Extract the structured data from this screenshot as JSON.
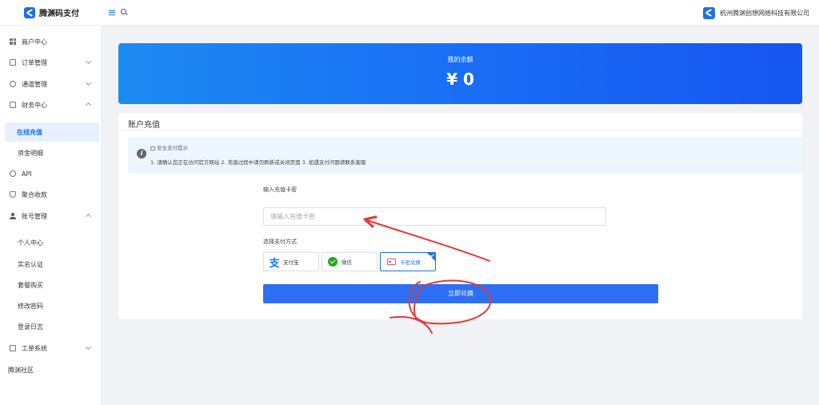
{
  "app": {
    "name": "腾渊码支付"
  },
  "header": {
    "company": "杭州腾渊创想网络科技有限公司"
  },
  "sidebar": {
    "items": [
      {
        "label": "商户中心"
      },
      {
        "label": "订单管理"
      },
      {
        "label": "通道管理"
      },
      {
        "label": "财务中心"
      },
      {
        "label": "在线充值"
      },
      {
        "label": "资金明细"
      },
      {
        "label": "API"
      },
      {
        "label": "聚合收款"
      },
      {
        "label": "账号管理"
      },
      {
        "label": "个人中心"
      },
      {
        "label": "实名认证"
      },
      {
        "label": "套餐购买"
      },
      {
        "label": "修改密码"
      },
      {
        "label": "登录日志"
      },
      {
        "label": "工单系统"
      },
      {
        "label": "腾渊社区"
      }
    ]
  },
  "balance": {
    "label": "我的余额",
    "amount": "¥ 0"
  },
  "recharge": {
    "title": "账户充值",
    "tip_title": "安全支付提示",
    "tip_text": "1. 请确认您正在访问官方网站 2. 充值过程中请勿刷新或关闭页面 3. 如遇支付问题请联系客服",
    "code_label": "输入充值卡密",
    "code_placeholder": "请输入充值卡密",
    "code_value": "",
    "method_label": "选择支付方式",
    "methods": [
      {
        "label": "支付宝",
        "icon": "alipay-icon",
        "selected": false
      },
      {
        "label": "微信",
        "icon": "wechat-icon",
        "selected": false
      },
      {
        "label": "卡密兑换",
        "icon": "card-icon",
        "selected": true
      }
    ],
    "submit_label": "立即兑换"
  },
  "annotations": {
    "color": "#e53935"
  }
}
